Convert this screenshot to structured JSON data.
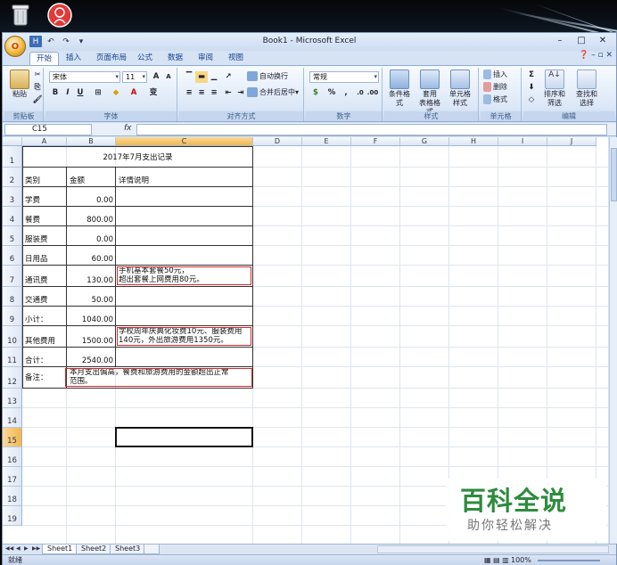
{
  "desktop": {
    "icons": [
      "recycle-bin-icon",
      "app-shortcut-icon"
    ]
  },
  "window": {
    "title": "Book1 - Microsoft Excel",
    "office_button": "O",
    "qat": [
      "H",
      "↶",
      "↷",
      "▾"
    ],
    "controls": {
      "minimize": "–",
      "maximize": "□",
      "close": "✕"
    }
  },
  "tabs": [
    "开始",
    "插入",
    "页面布局",
    "公式",
    "数据",
    "审阅",
    "视图"
  ],
  "ribbon": {
    "clipboard": {
      "label": "剪贴板",
      "paste": "粘贴"
    },
    "font": {
      "label": "字体",
      "name": "宋体",
      "size": "11",
      "grow": "A",
      "shrink": "A",
      "bold": "B",
      "italic": "I",
      "underline": "U",
      "phonetic": "变"
    },
    "alignment": {
      "label": "对齐方式",
      "wrap": "自动换行",
      "merge": "合并后居中"
    },
    "number": {
      "label": "数字",
      "format": "常规",
      "percent": "%",
      "comma": ","
    },
    "styles": {
      "label": "样式",
      "conditional": "条件格式",
      "table_line1": "套用",
      "table_line2": "表格格式",
      "cell_line1": "单元格",
      "cell_line2": "样式"
    },
    "cells": {
      "label": "单元格",
      "insert": "插入",
      "delete": "删除",
      "format": "格式"
    },
    "editing": {
      "label": "编辑",
      "sum": "Σ",
      "sort_line1": "排序和",
      "sort_line2": "筛选",
      "find_line1": "查找和",
      "find_line2": "选择"
    }
  },
  "formula_bar": {
    "name_box": "C15",
    "fx": "fx",
    "value": ""
  },
  "grid": {
    "columns": [
      "A",
      "B",
      "C",
      "D",
      "E",
      "F",
      "G",
      "H",
      "I",
      "J"
    ],
    "rows": [
      "1",
      "2",
      "3",
      "4",
      "5",
      "6",
      "7",
      "8",
      "9",
      "10",
      "11",
      "12",
      "13",
      "14",
      "15",
      "16",
      "17",
      "18",
      "19"
    ],
    "selected_column": "C",
    "selected_row": "15",
    "title": "2017年7月支出记录",
    "header": {
      "a": "类别",
      "b": "金额",
      "c": "详情说明"
    },
    "data": [
      {
        "a": "学费",
        "b": "0.00",
        "c1": "",
        "c2": ""
      },
      {
        "a": "餐费",
        "b": "800.00",
        "c1": "",
        "c2": ""
      },
      {
        "a": "服装费",
        "b": "0.00",
        "c1": "",
        "c2": ""
      },
      {
        "a": "日用品",
        "b": "60.00",
        "c1": "",
        "c2": ""
      },
      {
        "a": "通讯费",
        "b": "130.00",
        "c1": "手机基本套餐50元，",
        "c2": "超出套餐上网费用80元。"
      },
      {
        "a": "交通费",
        "b": "50.00",
        "c1": "",
        "c2": ""
      },
      {
        "a": "小计：",
        "b": "1040.00",
        "c1": "",
        "c2": ""
      },
      {
        "a": "其他费用",
        "b": "1500.00",
        "c1": "学校周年庆典化妆费10元、服装费用",
        "c2": "140元，外出旅游费用1350元。"
      },
      {
        "a": "合计：",
        "b": "2540.00",
        "c1": "",
        "c2": ""
      }
    ],
    "note": {
      "a": "备注：",
      "text1": "本月支出偏高，餐费和旅游费用的金额超出正常",
      "text2": "范围。"
    }
  },
  "sheet_tabs": [
    "Sheet1",
    "Sheet2",
    "Sheet3"
  ],
  "active_sheet": "Sheet1",
  "sheet_nav": [
    "◀◀",
    "◀",
    "▶",
    "▶▶"
  ],
  "status": {
    "ready": "就绪",
    "zoom": "100%"
  },
  "watermark": {
    "title": "百科全说",
    "subtitle": "助你轻松解决"
  }
}
